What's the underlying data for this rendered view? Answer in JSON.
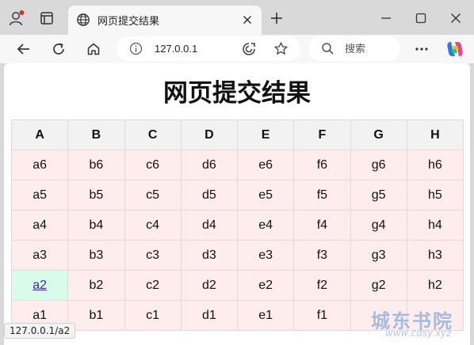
{
  "browser": {
    "tab_title": "网页提交结果",
    "url": "127.0.0.1",
    "search_placeholder": "搜索"
  },
  "page": {
    "heading": "网页提交结果",
    "columns": [
      "A",
      "B",
      "C",
      "D",
      "E",
      "F",
      "G",
      "H"
    ],
    "rows": [
      [
        "a6",
        "b6",
        "c6",
        "d6",
        "e6",
        "f6",
        "g6",
        "h6"
      ],
      [
        "a5",
        "b5",
        "c5",
        "d5",
        "e5",
        "f5",
        "g5",
        "h5"
      ],
      [
        "a4",
        "b4",
        "c4",
        "d4",
        "e4",
        "f4",
        "g4",
        "h4"
      ],
      [
        "a3",
        "b3",
        "c3",
        "d3",
        "e3",
        "f3",
        "g3",
        "h3"
      ],
      [
        "a2",
        "b2",
        "c2",
        "d2",
        "e2",
        "f2",
        "g2",
        "h2"
      ],
      [
        "a1",
        "b1",
        "c1",
        "d1",
        "e1",
        "f1",
        "",
        ""
      ]
    ],
    "linked_cell": "a2"
  },
  "status_bar": {
    "text": "127.0.0.1/a2"
  },
  "watermark": {
    "main": "城东书院",
    "sub": "www.cdsy.xyz"
  },
  "colors": {
    "header_bg": "#f2f2f2",
    "cell_bg": "#ffecec",
    "highlight_bg": "#d9fbe9",
    "link": "#3a2a9a"
  },
  "icons": {
    "profile": "profile-icon",
    "tab_actions": "tab-actions-icon",
    "favicon": "globe-icon",
    "back": "back-arrow-icon",
    "reload": "reload-icon",
    "home": "home-icon",
    "info": "info-icon",
    "read_aloud": "read-aloud-icon",
    "favorite": "star-icon",
    "search": "search-icon",
    "more": "more-icon",
    "copilot": "copilot-icon"
  }
}
